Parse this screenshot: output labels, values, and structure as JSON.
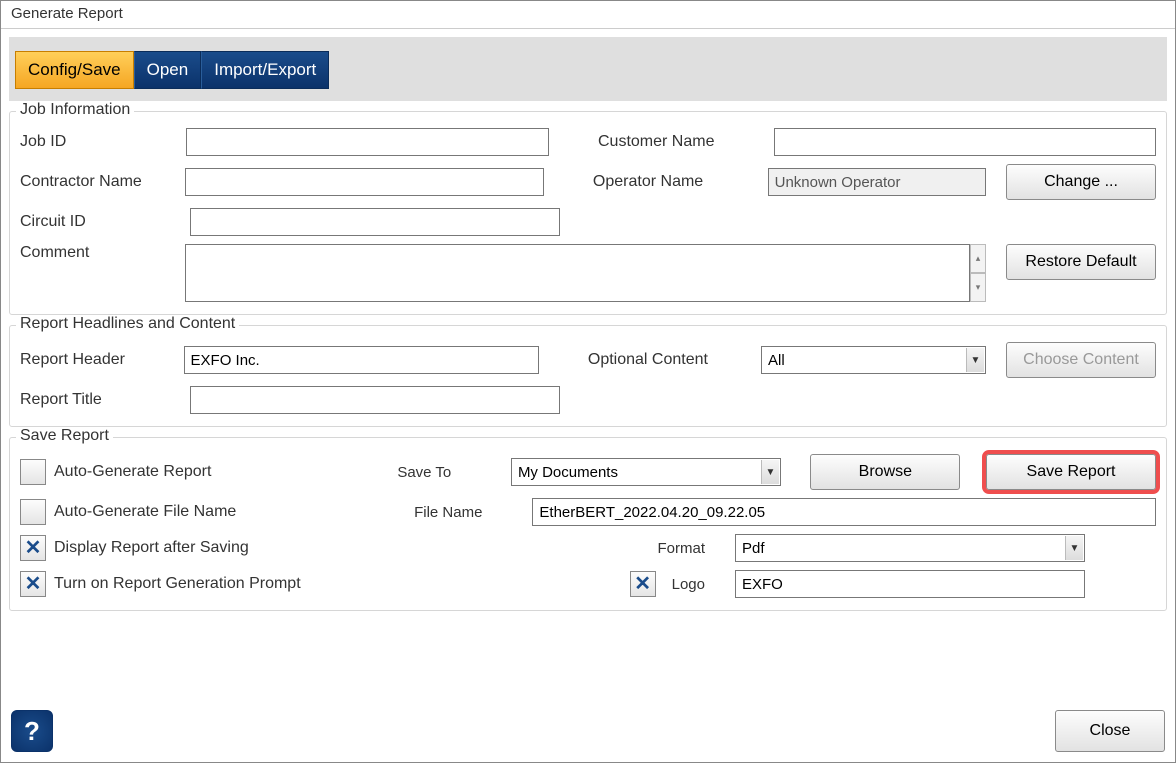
{
  "window": {
    "title": "Generate Report"
  },
  "tabs": {
    "config": "Config/Save",
    "open": "Open",
    "import_export": "Import/Export"
  },
  "job": {
    "legend": "Job Information",
    "job_id_label": "Job ID",
    "job_id_value": "",
    "customer_label": "Customer Name",
    "customer_value": "",
    "contractor_label": "Contractor Name",
    "contractor_value": "",
    "operator_label": "Operator Name",
    "operator_value": "Unknown Operator",
    "change_btn": "Change ...",
    "circuit_label": "Circuit ID",
    "circuit_value": "",
    "comment_label": "Comment",
    "comment_value": "",
    "restore_btn": "Restore Default"
  },
  "headlines": {
    "legend": "Report Headlines and Content",
    "header_label": "Report Header",
    "header_value": "EXFO Inc.",
    "optional_label": "Optional Content",
    "optional_value": "All",
    "choose_btn": "Choose Content",
    "title_label": "Report Title",
    "title_value": ""
  },
  "save": {
    "legend": "Save Report",
    "auto_gen_report": "Auto-Generate Report",
    "auto_gen_file": "Auto-Generate File Name",
    "display_after": "Display Report after Saving",
    "turn_on_prompt": "Turn on Report Generation Prompt",
    "save_to_label": "Save To",
    "save_to_value": "My Documents",
    "browse_btn": "Browse",
    "save_btn": "Save Report",
    "file_name_label": "File Name",
    "file_name_value": "EtherBERT_2022.04.20_09.22.05",
    "format_label": "Format",
    "format_value": "Pdf",
    "logo_label": "Logo",
    "logo_value": "EXFO"
  },
  "footer": {
    "close": "Close",
    "help_icon": "?"
  }
}
